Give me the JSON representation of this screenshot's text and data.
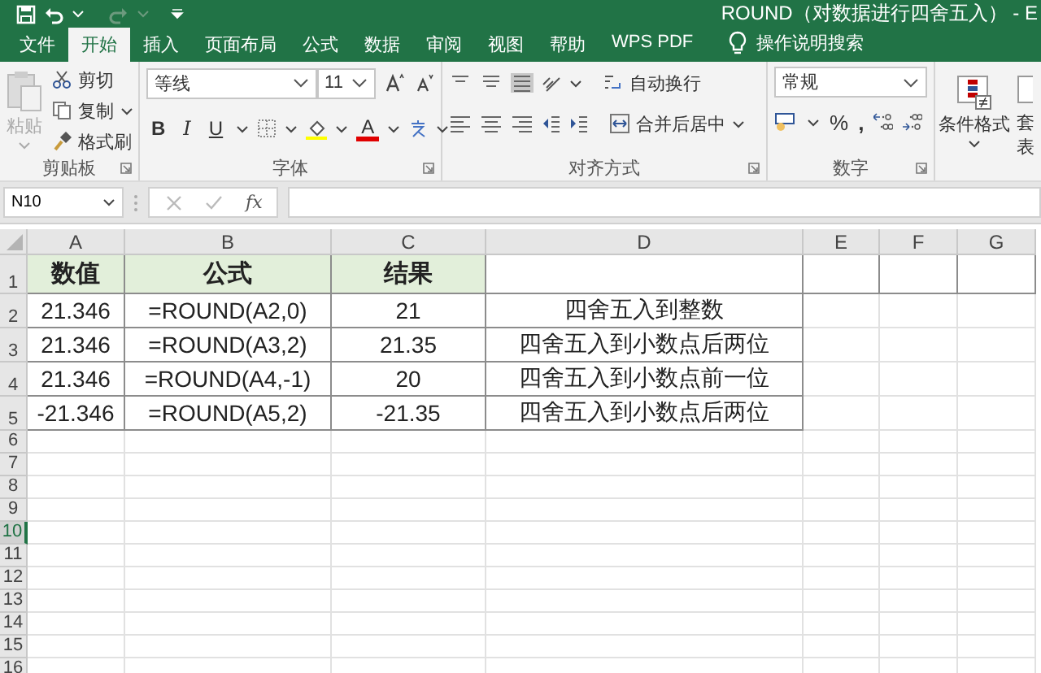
{
  "window": {
    "title": "ROUND（对数据进行四舍五入）  -  E"
  },
  "tabs": [
    {
      "label": "文件",
      "selected": false
    },
    {
      "label": "开始",
      "selected": true
    },
    {
      "label": "插入",
      "selected": false
    },
    {
      "label": "页面布局",
      "selected": false
    },
    {
      "label": "公式",
      "selected": false
    },
    {
      "label": "数据",
      "selected": false
    },
    {
      "label": "审阅",
      "selected": false
    },
    {
      "label": "视图",
      "selected": false
    },
    {
      "label": "帮助",
      "selected": false
    },
    {
      "label": "WPS PDF",
      "selected": false
    }
  ],
  "tell_me": {
    "label": "操作说明搜索"
  },
  "ribbon": {
    "clipboard": {
      "paste": "粘贴",
      "cut": "剪切",
      "copy": "复制",
      "format_painter": "格式刷",
      "label": "剪贴板"
    },
    "font": {
      "name": "等线",
      "size": "11",
      "bold": "B",
      "italic": "I",
      "underline": "U",
      "font_color": "A",
      "label": "字体"
    },
    "alignment": {
      "wrap": "自动换行",
      "merge": "合并后居中",
      "label": "对齐方式"
    },
    "number": {
      "format": "常规",
      "percent": "%",
      "comma": ",",
      "label": "数字"
    },
    "styles": {
      "conditional": "条件格式",
      "table_lines": [
        "套",
        "表"
      ]
    }
  },
  "formula_bar": {
    "name_box": "N10",
    "fx": "fx"
  },
  "sheet": {
    "columns": [
      "A",
      "B",
      "C",
      "D",
      "E",
      "F",
      "G"
    ],
    "rows": [
      {
        "number": "1",
        "kind": "header",
        "selected": false,
        "cells": [
          "数值",
          "公式",
          "结果"
        ]
      },
      {
        "number": "2",
        "kind": "data",
        "selected": false,
        "cells": [
          "21.346",
          "=ROUND(A2,0)",
          "21",
          "四舍五入到整数"
        ]
      },
      {
        "number": "3",
        "kind": "data",
        "selected": false,
        "cells": [
          "21.346",
          "=ROUND(A3,2)",
          "21.35",
          "四舍五入到小数点后两位"
        ]
      },
      {
        "number": "4",
        "kind": "data",
        "selected": false,
        "cells": [
          "21.346",
          "=ROUND(A4,-1)",
          "20",
          "四舍五入到小数点前一位"
        ]
      },
      {
        "number": "5",
        "kind": "data",
        "selected": false,
        "cells": [
          "-21.346",
          "=ROUND(A5,2)",
          "-21.35",
          "四舍五入到小数点后两位"
        ]
      },
      {
        "number": "6",
        "kind": "empty",
        "selected": false
      },
      {
        "number": "7",
        "kind": "empty",
        "selected": false
      },
      {
        "number": "8",
        "kind": "empty",
        "selected": false
      },
      {
        "number": "9",
        "kind": "empty",
        "selected": false
      },
      {
        "number": "10",
        "kind": "empty",
        "selected": true
      },
      {
        "number": "11",
        "kind": "empty",
        "selected": false
      },
      {
        "number": "12",
        "kind": "empty",
        "selected": false
      },
      {
        "number": "13",
        "kind": "empty",
        "selected": false
      },
      {
        "number": "14",
        "kind": "empty",
        "selected": false
      },
      {
        "number": "15",
        "kind": "empty",
        "selected": false
      },
      {
        "number": "16",
        "kind": "empty",
        "selected": false
      }
    ]
  }
}
